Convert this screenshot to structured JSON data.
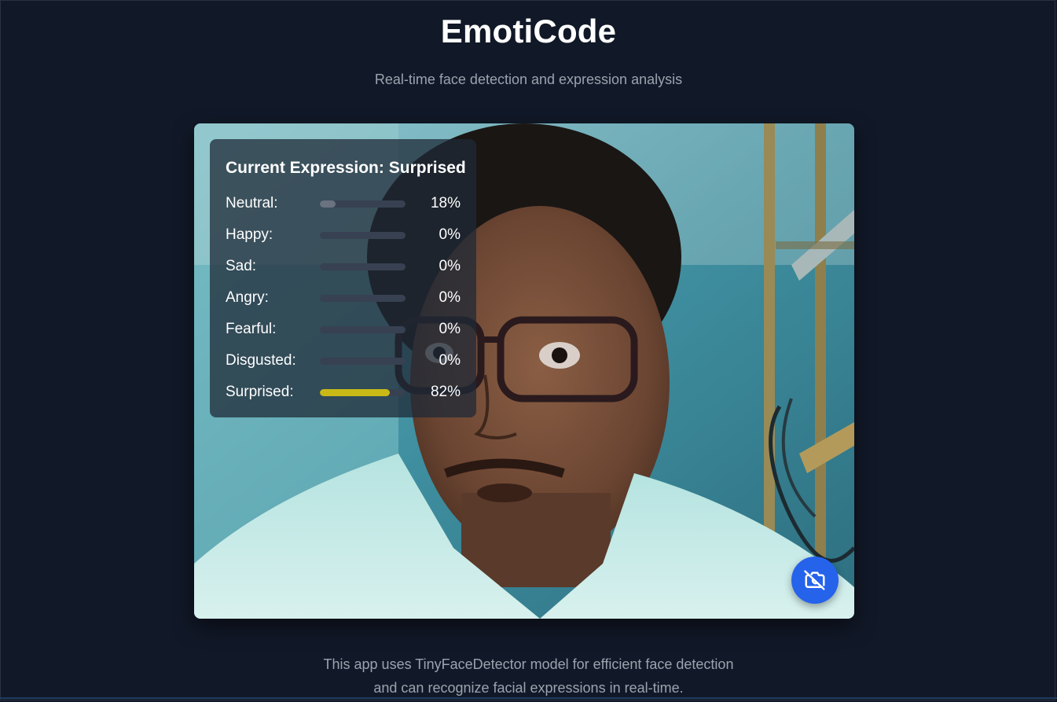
{
  "header": {
    "title": "EmotiCode",
    "subtitle": "Real-time face detection and expression analysis"
  },
  "overlay": {
    "title_prefix": "Current Expression:",
    "current_expression": "Surprised",
    "expressions": [
      {
        "label": "Neutral:",
        "value": 18,
        "value_text": "18%",
        "color": "#6b7280"
      },
      {
        "label": "Happy:",
        "value": 0,
        "value_text": "0%",
        "color": "#6b7280"
      },
      {
        "label": "Sad:",
        "value": 0,
        "value_text": "0%",
        "color": "#6b7280"
      },
      {
        "label": "Angry:",
        "value": 0,
        "value_text": "0%",
        "color": "#6b7280"
      },
      {
        "label": "Fearful:",
        "value": 0,
        "value_text": "0%",
        "color": "#6b7280"
      },
      {
        "label": "Disgusted:",
        "value": 0,
        "value_text": "0%",
        "color": "#6b7280"
      },
      {
        "label": "Surprised:",
        "value": 82,
        "value_text": "82%",
        "color": "#c8b917"
      }
    ]
  },
  "camera_button": {
    "icon": "camera-off-icon",
    "color": "#2563eb"
  },
  "footer": {
    "line1": "This app uses TinyFaceDetector model for efficient face detection",
    "line2": "and can recognize facial expressions in real-time."
  },
  "colors": {
    "background": "#111827",
    "overlay_bg": "#1f2937",
    "muted_text": "#9ca3af",
    "bar_track": "#374151"
  }
}
